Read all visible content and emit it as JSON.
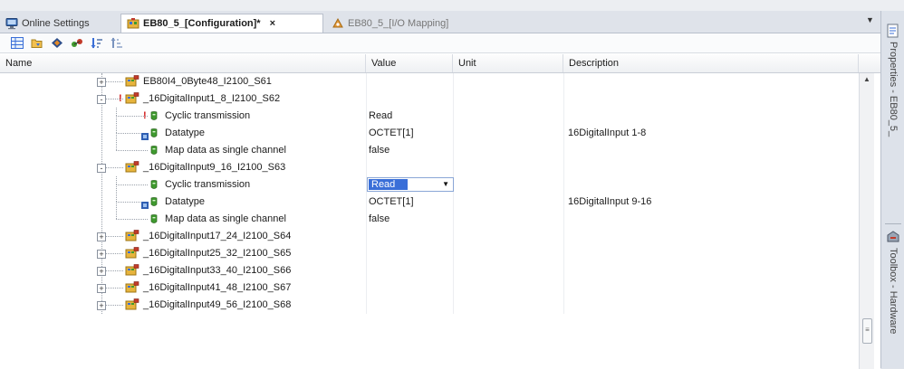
{
  "tabs": [
    {
      "label": "Online Settings",
      "icon": "monitor-icon",
      "active": false,
      "closable": false
    },
    {
      "label": "EB80_5_[Configuration]*",
      "icon": "config-icon",
      "active": true,
      "closable": true
    },
    {
      "label": "EB80_5_[I/O Mapping]",
      "icon": "io-mapping-icon",
      "active": false,
      "closable": false
    }
  ],
  "tab_close_glyph": "×",
  "toolbar": {
    "icons": [
      "grid-icon",
      "open-icon",
      "diamond-icon",
      "connect-icon",
      "sort-desc-icon",
      "sort-asc-icon"
    ]
  },
  "columns": {
    "name": "Name",
    "value": "Value",
    "unit": "Unit",
    "description": "Description"
  },
  "rows": [
    {
      "type": "node",
      "expander": "+",
      "label": "EB80I4_0Byte48_I2100_S61",
      "value": "",
      "description": ""
    },
    {
      "type": "node",
      "expander": "-",
      "label": "_16DigitalInput1_8_I2100_S62",
      "value": "",
      "description": "",
      "marker": "!"
    },
    {
      "type": "param",
      "label": "Cyclic transmission",
      "value": "Read",
      "description": "",
      "marker": "!"
    },
    {
      "type": "param",
      "label": "Datatype",
      "value": "OCTET[1]",
      "description": "16DigitalInput 1-8",
      "badge": true
    },
    {
      "type": "param",
      "label": "Map data as single channel",
      "value": "false",
      "description": ""
    },
    {
      "type": "node",
      "expander": "-",
      "label": "_16DigitalInput9_16_I2100_S63",
      "value": "",
      "description": ""
    },
    {
      "type": "param",
      "label": "Cyclic transmission",
      "value": "Read",
      "description": "",
      "editing": true
    },
    {
      "type": "param",
      "label": "Datatype",
      "value": "OCTET[1]",
      "description": "16DigitalInput 9-16",
      "badge": true
    },
    {
      "type": "param",
      "label": "Map data as single channel",
      "value": "false",
      "description": ""
    },
    {
      "type": "node",
      "expander": "+",
      "label": "_16DigitalInput17_24_I2100_S64",
      "value": "",
      "description": ""
    },
    {
      "type": "node",
      "expander": "+",
      "label": "_16DigitalInput25_32_I2100_S65",
      "value": "",
      "description": ""
    },
    {
      "type": "node",
      "expander": "+",
      "label": "_16DigitalInput33_40_I2100_S66",
      "value": "",
      "description": ""
    },
    {
      "type": "node",
      "expander": "+",
      "label": "_16DigitalInput41_48_I2100_S67",
      "value": "",
      "description": ""
    },
    {
      "type": "node",
      "expander": "+",
      "label": "_16DigitalInput49_56_I2100_S68",
      "value": "",
      "description": ""
    }
  ],
  "dropdown_glyph": "▼",
  "tab_dropdown_glyph": "▼",
  "scroll_up_glyph": "▲",
  "scroll_thumb_glyph": "≡",
  "side_panels": [
    {
      "label": "Properties - EB80_5_",
      "icon": "properties-icon"
    },
    {
      "label": "Toolbox - Hardware",
      "icon": "toolbox-icon"
    }
  ],
  "colors": {
    "accent": "#3a6fd8",
    "error_marker": "#d21a1a",
    "param_icon": "#3f9a2f"
  }
}
